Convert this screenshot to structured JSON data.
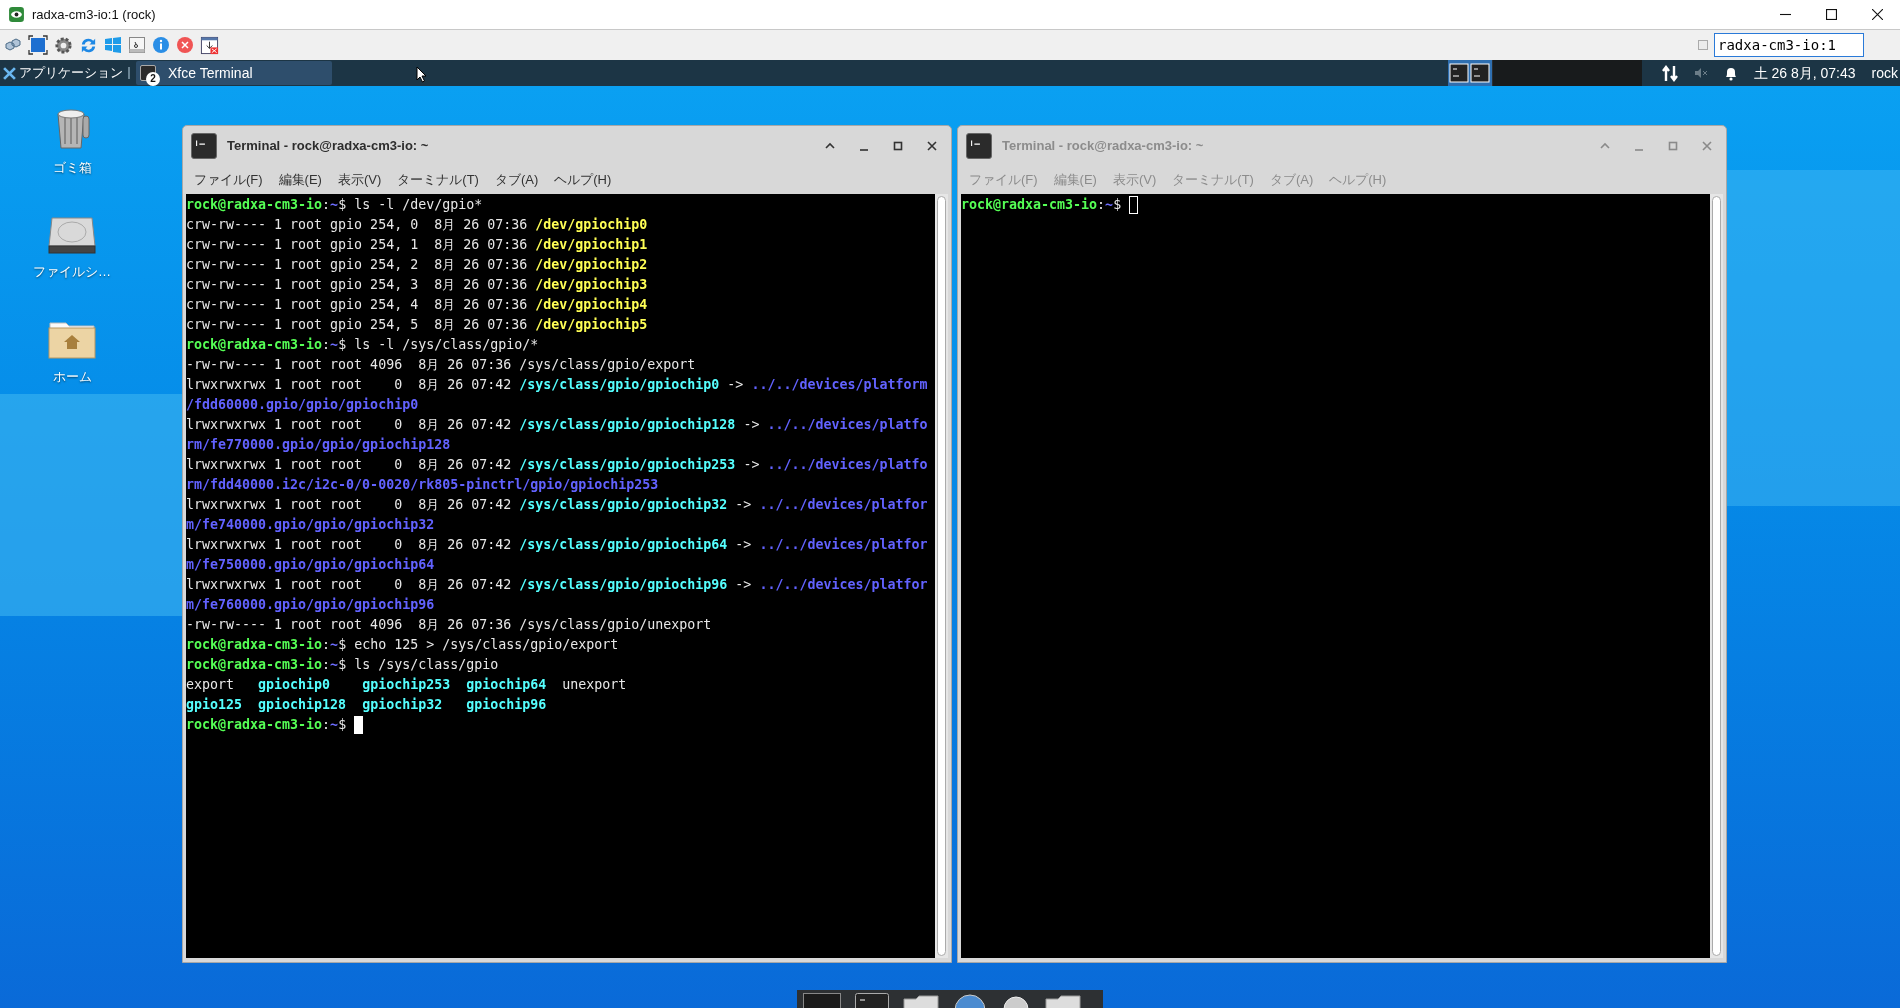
{
  "vnc_window": {
    "title": "radxa-cm3-io:1 (rock)",
    "host_field": "radxa-cm3-io:1",
    "checkbox": {
      "checked": false
    }
  },
  "panel": {
    "menu_label": "アプリケーション",
    "task": {
      "label": "Xfce Terminal",
      "count": "2"
    },
    "clock": "土 26 8月, 07:43",
    "user": "rock"
  },
  "desktop_icons": [
    {
      "label": "ゴミ箱",
      "kind": "trash"
    },
    {
      "label": "ファイルシ…",
      "kind": "drive"
    },
    {
      "label": "ホーム",
      "kind": "home"
    }
  ],
  "terminals": [
    {
      "title": "Terminal - rock@radxa-cm3-io: ~",
      "active": true,
      "menu": [
        "ファイル(F)",
        "編集(E)",
        "表示(V)",
        "ターミナル(T)",
        "タブ(A)",
        "ヘルプ(H)"
      ],
      "lines": [
        [
          {
            "kind": "user",
            "text": "rock@radxa-cm3-io"
          },
          {
            "kind": "plain",
            "text": ":"
          },
          {
            "kind": "path",
            "text": "~"
          },
          {
            "kind": "plain",
            "text": "$ ls -l /dev/gpio*"
          }
        ],
        [
          {
            "kind": "plain",
            "text": "crw-rw---- 1 root gpio 254, 0  8月 26 07:36 "
          },
          {
            "kind": "yellow",
            "text": "/dev/gpiochip0"
          }
        ],
        [
          {
            "kind": "plain",
            "text": "crw-rw---- 1 root gpio 254, 1  8月 26 07:36 "
          },
          {
            "kind": "yellow",
            "text": "/dev/gpiochip1"
          }
        ],
        [
          {
            "kind": "plain",
            "text": "crw-rw---- 1 root gpio 254, 2  8月 26 07:36 "
          },
          {
            "kind": "yellow",
            "text": "/dev/gpiochip2"
          }
        ],
        [
          {
            "kind": "plain",
            "text": "crw-rw---- 1 root gpio 254, 3  8月 26 07:36 "
          },
          {
            "kind": "yellow",
            "text": "/dev/gpiochip3"
          }
        ],
        [
          {
            "kind": "plain",
            "text": "crw-rw---- 1 root gpio 254, 4  8月 26 07:36 "
          },
          {
            "kind": "yellow",
            "text": "/dev/gpiochip4"
          }
        ],
        [
          {
            "kind": "plain",
            "text": "crw-rw---- 1 root gpio 254, 5  8月 26 07:36 "
          },
          {
            "kind": "yellow",
            "text": "/dev/gpiochip5"
          }
        ],
        [
          {
            "kind": "user",
            "text": "rock@radxa-cm3-io"
          },
          {
            "kind": "plain",
            "text": ":"
          },
          {
            "kind": "path",
            "text": "~"
          },
          {
            "kind": "plain",
            "text": "$ ls -l /sys/class/gpio/*"
          }
        ],
        [
          {
            "kind": "plain",
            "text": "-rw-rw---- 1 root root 4096  8月 26 07:36 /sys/class/gpio/export"
          }
        ],
        [
          {
            "kind": "plain",
            "text": "lrwxrwxrwx 1 root root    0  8月 26 07:42 "
          },
          {
            "kind": "cyan",
            "text": "/sys/class/gpio/gpiochip0"
          },
          {
            "kind": "plain",
            "text": " -> "
          },
          {
            "kind": "link",
            "text": "../../devices/platform"
          }
        ],
        [
          {
            "kind": "link",
            "text": "/fdd60000.gpio/gpio/gpiochip0"
          }
        ],
        [
          {
            "kind": "plain",
            "text": "lrwxrwxrwx 1 root root    0  8月 26 07:42 "
          },
          {
            "kind": "cyan",
            "text": "/sys/class/gpio/gpiochip128"
          },
          {
            "kind": "plain",
            "text": " -> "
          },
          {
            "kind": "link",
            "text": "../../devices/platfo"
          }
        ],
        [
          {
            "kind": "link",
            "text": "rm/fe770000.gpio/gpio/gpiochip128"
          }
        ],
        [
          {
            "kind": "plain",
            "text": "lrwxrwxrwx 1 root root    0  8月 26 07:42 "
          },
          {
            "kind": "cyan",
            "text": "/sys/class/gpio/gpiochip253"
          },
          {
            "kind": "plain",
            "text": " -> "
          },
          {
            "kind": "link",
            "text": "../../devices/platfo"
          }
        ],
        [
          {
            "kind": "link",
            "text": "rm/fdd40000.i2c/i2c-0/0-0020/rk805-pinctrl/gpio/gpiochip253"
          }
        ],
        [
          {
            "kind": "plain",
            "text": "lrwxrwxrwx 1 root root    0  8月 26 07:42 "
          },
          {
            "kind": "cyan",
            "text": "/sys/class/gpio/gpiochip32"
          },
          {
            "kind": "plain",
            "text": " -> "
          },
          {
            "kind": "link",
            "text": "../../devices/platfor"
          }
        ],
        [
          {
            "kind": "link",
            "text": "m/fe740000.gpio/gpio/gpiochip32"
          }
        ],
        [
          {
            "kind": "plain",
            "text": "lrwxrwxrwx 1 root root    0  8月 26 07:42 "
          },
          {
            "kind": "cyan",
            "text": "/sys/class/gpio/gpiochip64"
          },
          {
            "kind": "plain",
            "text": " -> "
          },
          {
            "kind": "link",
            "text": "../../devices/platfor"
          }
        ],
        [
          {
            "kind": "link",
            "text": "m/fe750000.gpio/gpio/gpiochip64"
          }
        ],
        [
          {
            "kind": "plain",
            "text": "lrwxrwxrwx 1 root root    0  8月 26 07:42 "
          },
          {
            "kind": "cyan",
            "text": "/sys/class/gpio/gpiochip96"
          },
          {
            "kind": "plain",
            "text": " -> "
          },
          {
            "kind": "link",
            "text": "../../devices/platfor"
          }
        ],
        [
          {
            "kind": "link",
            "text": "m/fe760000.gpio/gpio/gpiochip96"
          }
        ],
        [
          {
            "kind": "plain",
            "text": "-rw-rw---- 1 root root 4096  8月 26 07:36 /sys/class/gpio/unexport"
          }
        ],
        [
          {
            "kind": "user",
            "text": "rock@radxa-cm3-io"
          },
          {
            "kind": "plain",
            "text": ":"
          },
          {
            "kind": "path",
            "text": "~"
          },
          {
            "kind": "plain",
            "text": "$ echo 125 > /sys/class/gpio/export"
          }
        ],
        [
          {
            "kind": "user",
            "text": "rock@radxa-cm3-io"
          },
          {
            "kind": "plain",
            "text": ":"
          },
          {
            "kind": "path",
            "text": "~"
          },
          {
            "kind": "plain",
            "text": "$ ls /sys/class/gpio"
          }
        ],
        [
          {
            "kind": "plain",
            "text": "export   "
          },
          {
            "kind": "cyan",
            "text": "gpiochip0    "
          },
          {
            "kind": "cyan",
            "text": "gpiochip253  "
          },
          {
            "kind": "cyan",
            "text": "gpiochip64"
          },
          {
            "kind": "plain",
            "text": "  unexport"
          }
        ],
        [
          {
            "kind": "cyan",
            "text": "gpio125  "
          },
          {
            "kind": "cyan",
            "text": "gpiochip128  "
          },
          {
            "kind": "cyan",
            "text": "gpiochip32   "
          },
          {
            "kind": "cyan",
            "text": "gpiochip96"
          }
        ],
        [
          {
            "kind": "user",
            "text": "rock@radxa-cm3-io"
          },
          {
            "kind": "plain",
            "text": ":"
          },
          {
            "kind": "path",
            "text": "~"
          },
          {
            "kind": "plain",
            "text": "$"
          }
        ]
      ]
    },
    {
      "title": "Terminal - rock@radxa-cm3-io: ~",
      "active": false,
      "menu": [
        "ファイル(F)",
        "編集(E)",
        "表示(V)",
        "ターミナル(T)",
        "タブ(A)",
        "ヘルプ(H)"
      ],
      "lines": [
        [
          {
            "kind": "user",
            "text": "rock@radxa-cm3-io"
          },
          {
            "kind": "plain",
            "text": ":"
          },
          {
            "kind": "path",
            "text": "~"
          },
          {
            "kind": "plain",
            "text": "$"
          }
        ]
      ]
    }
  ]
}
